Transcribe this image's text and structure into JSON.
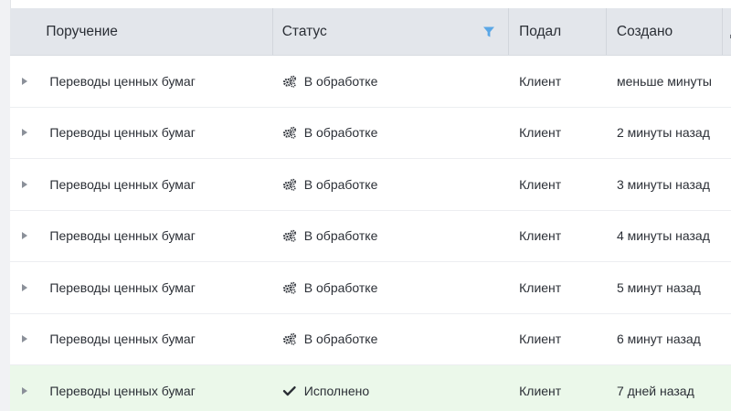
{
  "columns": {
    "order": "Поручение",
    "status": "Статус",
    "submitted_by": "Подал",
    "created": "Создано",
    "next_partial": "Д"
  },
  "rows": [
    {
      "order": "Переводы ценных бумаг",
      "status": "В обработке",
      "status_icon": "gears-icon",
      "submitted_by": "Клиент",
      "created": "меньше минуты"
    },
    {
      "order": "Переводы ценных бумаг",
      "status": "В обработке",
      "status_icon": "gears-icon",
      "submitted_by": "Клиент",
      "created": "2 минуты назад"
    },
    {
      "order": "Переводы ценных бумаг",
      "status": "В обработке",
      "status_icon": "gears-icon",
      "submitted_by": "Клиент",
      "created": "3 минуты назад"
    },
    {
      "order": "Переводы ценных бумаг",
      "status": "В обработке",
      "status_icon": "gears-icon",
      "submitted_by": "Клиент",
      "created": "4 минуты назад"
    },
    {
      "order": "Переводы ценных бумаг",
      "status": "В обработке",
      "status_icon": "gears-icon",
      "submitted_by": "Клиент",
      "created": "5 минут назад"
    },
    {
      "order": "Переводы ценных бумаг",
      "status": "В обработке",
      "status_icon": "gears-icon",
      "submitted_by": "Клиент",
      "created": "6 минут назад"
    },
    {
      "order": "Переводы ценных бумаг",
      "status": "Исполнено",
      "status_icon": "checkmark-icon",
      "submitted_by": "Клиент",
      "created": "7 дней назад"
    }
  ],
  "colors": {
    "header_bg": "#e3e6eb",
    "done_row_bg": "#ebf8ea",
    "filter_icon": "#5aa7e6"
  }
}
